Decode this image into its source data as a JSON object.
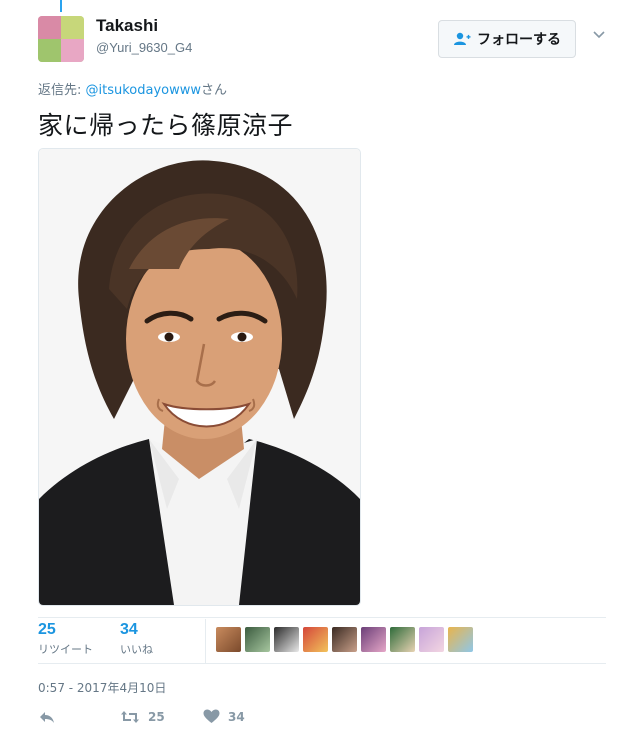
{
  "tweet": {
    "author_name": "Takashi",
    "author_handle": "@Yuri_9630_G4",
    "reply_prefix": "返信先: ",
    "reply_mention": "@itsukodayowww",
    "reply_suffix": "さん",
    "text": "家に帰ったら篠原涼子",
    "media_description": "photo of a smiling man with wavy brown hair in a dark jacket and white shirt",
    "timestamp": "0:57 - 2017年4月10日"
  },
  "follow_button": {
    "label": "フォローする",
    "icon": "add-user-icon"
  },
  "stats": {
    "retweets": {
      "count": "25",
      "label": "リツイート"
    },
    "likes": {
      "count": "34",
      "label": "いいね"
    }
  },
  "liker_avatars": [
    {
      "colors": [
        "#c98b5e",
        "#7b4a2c"
      ]
    },
    {
      "colors": [
        "#3b5b3f",
        "#a7c7a0"
      ]
    },
    {
      "colors": [
        "#2b2b2b",
        "#e9e9e9"
      ]
    },
    {
      "colors": [
        "#d4463a",
        "#f2c35b"
      ]
    },
    {
      "colors": [
        "#3a2a22",
        "#c9a08a"
      ]
    },
    {
      "colors": [
        "#6b3f78",
        "#e6a7c8"
      ]
    },
    {
      "colors": [
        "#2f6b3a",
        "#e8d3b3"
      ]
    },
    {
      "colors": [
        "#c7a4d9",
        "#f3d6e2"
      ]
    },
    {
      "colors": [
        "#e9b44c",
        "#8fc7e8"
      ]
    }
  ],
  "actions": {
    "reply": {
      "icon": "reply-icon"
    },
    "retweet": {
      "icon": "retweet-icon",
      "count": "25"
    },
    "like": {
      "icon": "heart-icon",
      "count": "34"
    }
  },
  "colors": {
    "accent": "#1b95e0",
    "muted": "#657786",
    "icon_gray": "#8899a6"
  }
}
